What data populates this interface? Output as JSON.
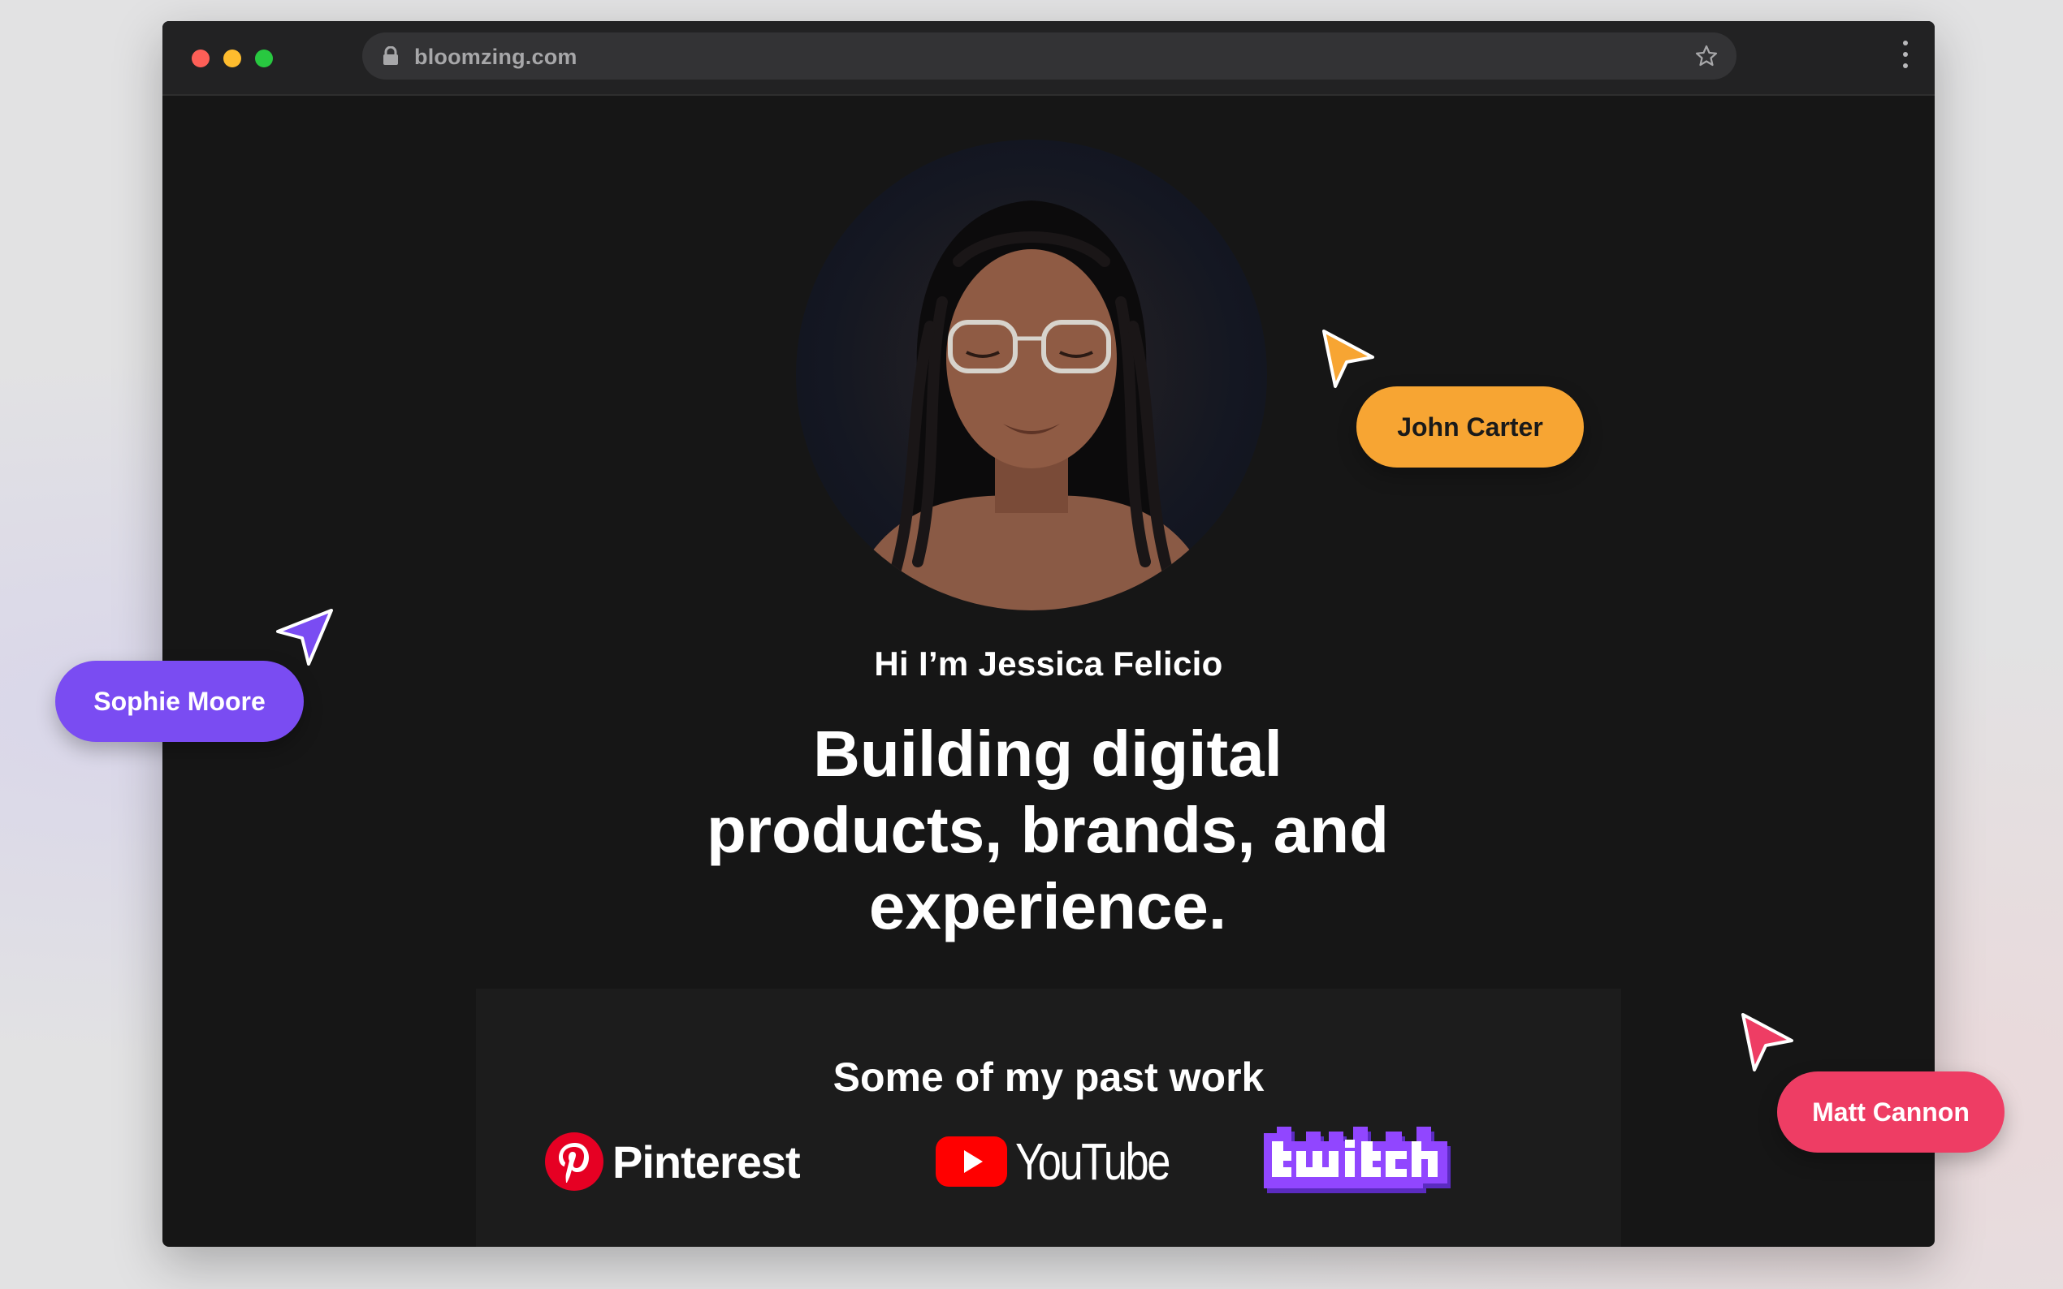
{
  "browser": {
    "url": "bloomzing.com"
  },
  "hero": {
    "greeting": "Hi I’m Jessica Felicio",
    "headline": "Building digital products, brands, and experience."
  },
  "past_work": {
    "title": "Some of my past work",
    "logos": [
      {
        "name": "Pinterest",
        "icon": "pinterest-logo"
      },
      {
        "name": "YouTube",
        "icon": "youtube-logo"
      },
      {
        "name": "twitch",
        "icon": "twitch-logo"
      }
    ]
  },
  "collaborators": [
    {
      "name": "John Carter",
      "color": "#f7a533"
    },
    {
      "name": "Sophie Moore",
      "color": "#7a4cf2"
    },
    {
      "name": "Matt Cannon",
      "color": "#ee3d64"
    }
  ],
  "colors": {
    "page_bg": "#161616",
    "titlebar": "#222223",
    "pinterest_red": "#e60023",
    "youtube_red": "#ff0000",
    "twitch_purple": "#9146ff"
  }
}
